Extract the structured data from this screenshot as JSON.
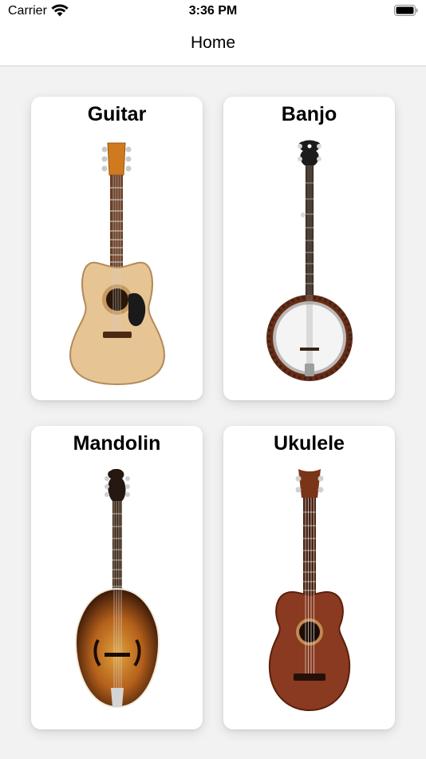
{
  "status_bar": {
    "carrier": "Carrier",
    "time": "3:36 PM",
    "wifi_icon": "wifi-icon",
    "battery_icon": "battery-icon"
  },
  "nav": {
    "title": "Home"
  },
  "cards": [
    {
      "title": "Guitar",
      "image_icon": "acoustic-guitar-image"
    },
    {
      "title": "Banjo",
      "image_icon": "banjo-image"
    },
    {
      "title": "Mandolin",
      "image_icon": "mandolin-image"
    },
    {
      "title": "Ukulele",
      "image_icon": "ukulele-image"
    }
  ],
  "colors": {
    "background": "#f2f2f2",
    "card": "#ffffff",
    "text": "#000000"
  }
}
